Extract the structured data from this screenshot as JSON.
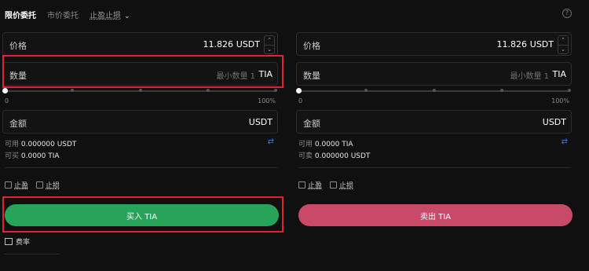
{
  "tabs": {
    "limit": "限价委托",
    "market": "市价委托",
    "tpsl": "止盈止损",
    "tpsl_chevron": "chevron-down-icon"
  },
  "buy": {
    "price_label": "价格",
    "price_value": "11.826",
    "price_unit": "USDT",
    "qty_label": "数量",
    "qty_placeholder": "最小数量 1",
    "qty_unit": "TIA",
    "slider_min": "0",
    "slider_max": "100%",
    "amount_label": "金额",
    "amount_unit": "USDT",
    "available_label": "可用",
    "available_value": "0.000000 USDT",
    "can_buy_label": "可买",
    "can_buy_value": "0.0000 TIA",
    "tp_label": "止盈",
    "sl_label": "止损",
    "button_label": "买入 TIA"
  },
  "sell": {
    "price_label": "价格",
    "price_value": "11.826",
    "price_unit": "USDT",
    "qty_label": "数量",
    "qty_placeholder": "最小数量 1",
    "qty_unit": "TIA",
    "slider_min": "0",
    "slider_max": "100%",
    "amount_label": "金额",
    "amount_unit": "USDT",
    "available_label": "可用",
    "available_value": "0.0000 TIA",
    "can_sell_label": "可卖",
    "can_sell_value": "0.000000 USDT",
    "tp_label": "止盈",
    "sl_label": "止损",
    "button_label": "卖出 TIA"
  },
  "footer": {
    "fee_label": "费率"
  },
  "colors": {
    "buy": "#27a35a",
    "sell": "#c94a68",
    "highlight": "#e0242b"
  }
}
